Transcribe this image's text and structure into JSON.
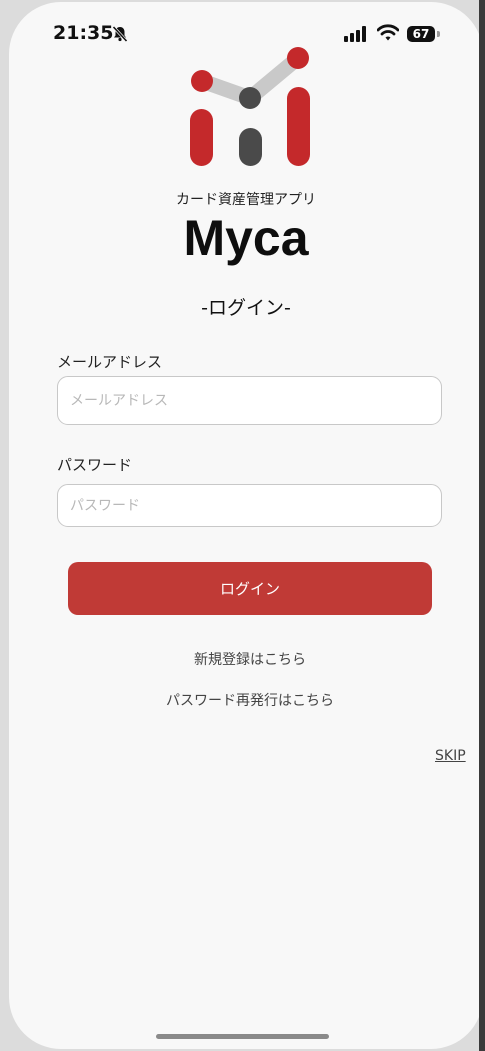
{
  "status_bar": {
    "time": "21:35",
    "battery": "67",
    "icons": [
      "bell-slash-icon",
      "cellular-signal-icon",
      "wifi-icon",
      "battery-icon"
    ]
  },
  "app": {
    "subtitle": "カード資産管理アプリ",
    "name": "Myca",
    "screen_title": "-ログイン-"
  },
  "form": {
    "email_label": "メールアドレス",
    "email_placeholder": "メールアドレス",
    "email_value": "",
    "password_label": "パスワード",
    "password_placeholder": "パスワード",
    "password_value": "",
    "login_button": "ログイン"
  },
  "links": {
    "register": "新規登録はこちら",
    "reset_password": "パスワード再発行はこちら",
    "skip": "SKIP"
  },
  "colors": {
    "accent": "#c03a36",
    "logo_red": "#c4292b",
    "logo_dark": "#4a4a4a",
    "logo_gray": "#c9c9c9",
    "background": "#f8f8f8"
  }
}
